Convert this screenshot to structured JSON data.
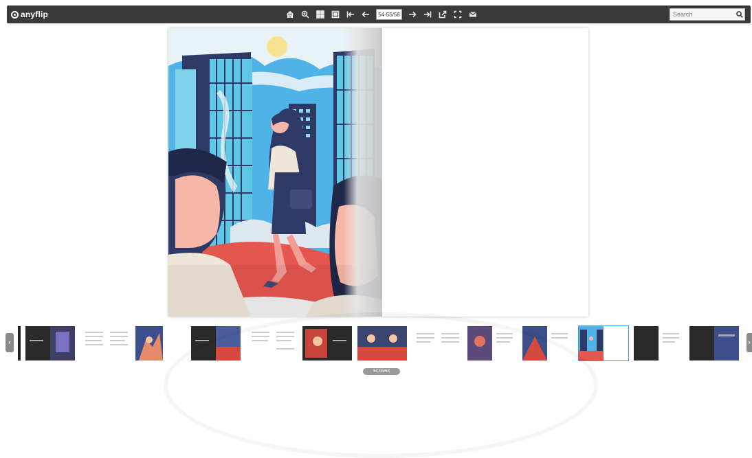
{
  "app": {
    "logo_text": "anyflip"
  },
  "toolbar": {
    "tools_left": [
      {
        "icon": "home-icon"
      },
      {
        "icon": "zoom-in-icon"
      },
      {
        "icon": "thumbnails-icon"
      },
      {
        "icon": "single-page-icon"
      },
      {
        "icon": "first-page-icon"
      },
      {
        "icon": "prev-page-icon"
      }
    ],
    "page_value": "54-55/58",
    "tools_right": [
      {
        "icon": "next-page-icon"
      },
      {
        "icon": "last-page-icon"
      },
      {
        "icon": "share-icon"
      },
      {
        "icon": "fullscreen-icon"
      },
      {
        "icon": "email-icon"
      }
    ],
    "search_placeholder": "Search"
  },
  "book": {
    "current_spread": "54-55/58"
  },
  "thumbnails": {
    "prev_label": "‹",
    "next_label": "›",
    "current_label": "54-55/58"
  }
}
